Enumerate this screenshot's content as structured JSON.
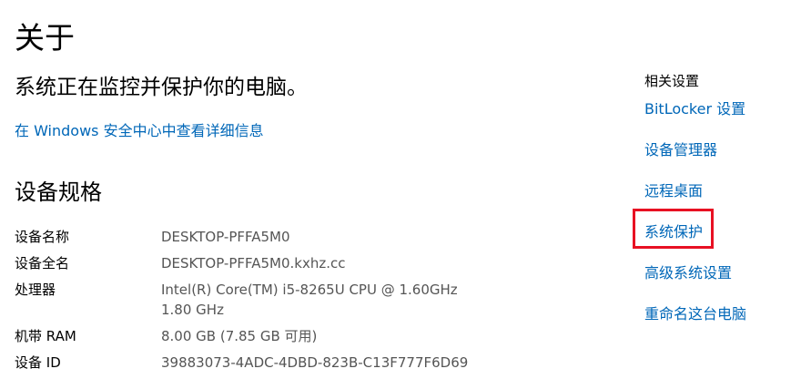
{
  "page": {
    "title": "关于",
    "protection_message": "系统正在监控并保护你的电脑。",
    "security_link": "在 Windows 安全中心中查看详细信息"
  },
  "device_specs": {
    "title": "设备规格",
    "rows": [
      {
        "label": "设备名称",
        "value": "DESKTOP-PFFA5M0"
      },
      {
        "label": "设备全名",
        "value": "DESKTOP-PFFA5M0.kxhz.cc"
      },
      {
        "label": "处理器",
        "value": "Intel(R) Core(TM) i5-8265U CPU @ 1.60GHz   1.80 GHz"
      },
      {
        "label": "机带 RAM",
        "value": "8.00 GB (7.85 GB 可用)"
      },
      {
        "label": "设备 ID",
        "value": "39883073-4ADC-4DBD-823B-C13F777F6D69"
      }
    ]
  },
  "related_settings": {
    "title": "相关设置",
    "links": [
      "BitLocker 设置",
      "设备管理器",
      "远程桌面",
      "系统保护",
      "高级系统设置",
      "重命名这台电脑"
    ],
    "highlighted_index": 3,
    "highlight_color": "#e81123"
  },
  "colors": {
    "link": "#0067b8",
    "text": "#000000",
    "value_text": "#555555",
    "background": "#ffffff"
  }
}
